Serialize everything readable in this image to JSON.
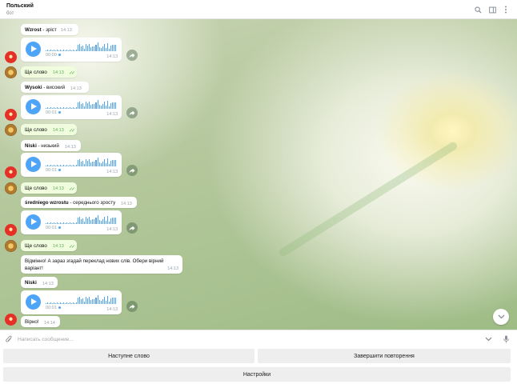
{
  "header": {
    "title": "Польский",
    "status": "бот",
    "icons": [
      "search-icon",
      "sidebar-toggle-icon",
      "more-vertical-icon"
    ]
  },
  "messages": [
    {
      "word": "Wzrost",
      "translation": " - зріст",
      "time": "14:13"
    },
    {
      "voice_start": "00:00",
      "voice_time": "14:13"
    },
    {
      "text": "Ще слово",
      "time": "14:13"
    },
    {
      "word": "Wysoki",
      "translation": " - високий",
      "time": "14:13"
    },
    {
      "voice_start": "00:01",
      "voice_time": "14:13"
    },
    {
      "text": "Ще слово",
      "time": "14:13"
    },
    {
      "word": "Niski",
      "translation": " - низький",
      "time": "14:13"
    },
    {
      "voice_start": "00:01",
      "voice_time": "14:13"
    },
    {
      "text": "Ще слово",
      "time": "14:13"
    },
    {
      "word": "średniego wzrostu",
      "translation": " - середнього зросту",
      "time": "14:13"
    },
    {
      "voice_start": "00:01",
      "voice_time": "14:13"
    },
    {
      "text": "Ще слово",
      "time": "14:13"
    },
    {
      "line1": "Відмінно! А зараз згадай переклад нових слів. Обери вірний",
      "line2": "варіант!",
      "time": "14:13"
    },
    {
      "word": "Niski",
      "time": "14:13"
    },
    {
      "voice_start": "00:01",
      "voice_time": "14:13"
    },
    {
      "text": "Вірно!",
      "time": "14:14"
    }
  ],
  "composer": {
    "placeholder": "Написать сообщение..."
  },
  "keyboard": {
    "next_word": "Наступне слово",
    "finish": "Завершити повторення",
    "settings": "Настройки"
  },
  "colors": {
    "accent": "#4ea4f6",
    "outgoing_bubble": "#effdde",
    "read_check": "#4fae4e",
    "bot_avatar": "#e43027"
  }
}
